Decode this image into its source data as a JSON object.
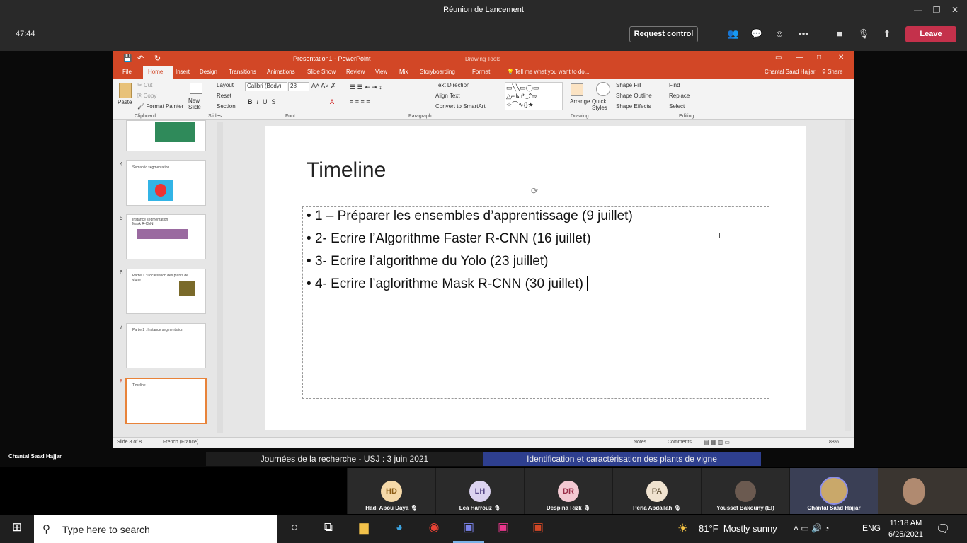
{
  "teams": {
    "window_title": "Réunion de Lancement",
    "timer": "47:44",
    "request_control": "Request control",
    "leave": "Leave",
    "presenter_name": "Chantal Saad Hajjar"
  },
  "ppt": {
    "title": "Presentation1 - PowerPoint",
    "drawing_tools": "Drawing Tools",
    "user": "Chantal Saad Hajjar",
    "share": "Share",
    "tell_me": "Tell me what you want to do...",
    "tabs": [
      "File",
      "Home",
      "Insert",
      "Design",
      "Transitions",
      "Animations",
      "Slide Show",
      "Review",
      "View",
      "Mix",
      "Storyboarding",
      "Format"
    ],
    "ribbon": {
      "paste": "Paste",
      "cut": "Cut",
      "copy": "Copy",
      "format_painter": "Format Painter",
      "new_slide": "New Slide",
      "layout": "Layout",
      "reset": "Reset",
      "section": "Section",
      "font_name": "Calibri (Body)",
      "font_size": "28",
      "text_direction": "Text Direction",
      "align_text": "Align Text",
      "convert_smartart": "Convert to SmartArt",
      "arrange": "Arrange",
      "quick_styles": "Quick Styles",
      "shape_fill": "Shape Fill",
      "shape_outline": "Shape Outline",
      "shape_effects": "Shape Effects",
      "find": "Find",
      "replace": "Replace",
      "select": "Select",
      "groups": [
        "Clipboard",
        "Slides",
        "Font",
        "Paragraph",
        "Drawing",
        "Editing"
      ]
    },
    "thumbnails": [
      {
        "num": "4",
        "title": "Semantic segmentation"
      },
      {
        "num": "5",
        "title": "Instance segmentation Mask R-CNN"
      },
      {
        "num": "6",
        "title": "Partie 1 : Localisation des plants de vigne"
      },
      {
        "num": "7",
        "title": "Partie 2 : Instance segmentation"
      },
      {
        "num": "8",
        "title": "Timeline"
      }
    ],
    "slide": {
      "title": "Timeline",
      "bullets": [
        "1 – Préparer les ensembles d’apprentissage (9 juillet)",
        "2- Ecrire l’Algorithme Faster R-CNN (16 juillet)",
        "3- Ecrire l’algorithme du Yolo (23 juillet)",
        "4- Ecrire l’aglorithme Mask R-CNN (30 juillet)"
      ]
    },
    "status": {
      "slide_of": "Slide 8 of 8",
      "language": "French (France)",
      "notes": "Notes",
      "comments": "Comments",
      "zoom": "88%"
    }
  },
  "banner": {
    "left": "Journées de la recherche - USJ : 3 juin 2021",
    "right": "Identification et caractérisation des plants de vigne"
  },
  "participants": [
    {
      "initials": "HD",
      "name": "Hadi Abou Daya",
      "color": "#f5d9a8",
      "text_color": "#8a5a12"
    },
    {
      "initials": "LH",
      "name": "Lea Harrouz",
      "color": "#dcd3f0",
      "text_color": "#5a4a8a"
    },
    {
      "initials": "DR",
      "name": "Despina Rizk",
      "color": "#f3c9d2",
      "text_color": "#9a2e48"
    },
    {
      "initials": "PA",
      "name": "Perla Abdallah",
      "color": "#f0e3d0",
      "text_color": "#6a5a40"
    },
    {
      "initials": "",
      "name": "Youssef Bakouny (EI)",
      "color": "#6b5a50",
      "text_color": "#fff"
    },
    {
      "initials": "",
      "name": "Chantal Saad Hajjar",
      "color": "#c9a86a",
      "text_color": "#fff"
    }
  ],
  "taskbar": {
    "search_placeholder": "Type here to search",
    "temperature": "81°F",
    "weather": "Mostly sunny",
    "lang": "ENG",
    "time": "11:18 AM",
    "date": "6/25/2021"
  }
}
